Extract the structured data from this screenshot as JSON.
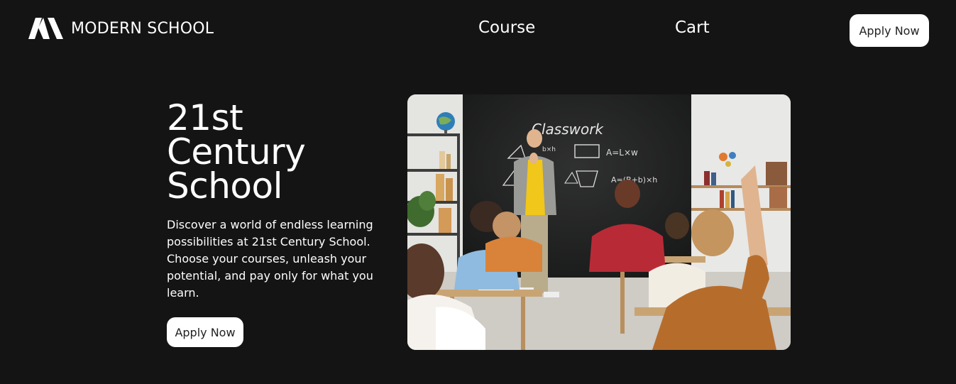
{
  "brand": {
    "name": "MODERN SCHOOL",
    "icon": "school-logo-mark-icon"
  },
  "nav": {
    "course": "Course",
    "cart": "Cart"
  },
  "header": {
    "apply_label": "Apply Now"
  },
  "hero": {
    "title_lines": [
      "21st",
      "Century",
      "School"
    ],
    "description": "Discover a world of endless learning possibilities at 21st Century School. Choose your courses, unleash your potential, and pay only for what you learn.",
    "apply_label": "Apply Now",
    "image": {
      "chalkboard_heading": "Classwork",
      "formula_area": "A=L×w",
      "formula_trapezoid": "A=(B+b)×h",
      "formula_triangle": "b×h"
    }
  },
  "colors": {
    "background": "#141414",
    "button_bg": "#ffffff",
    "button_text": "#222222",
    "text": "#ffffff"
  }
}
